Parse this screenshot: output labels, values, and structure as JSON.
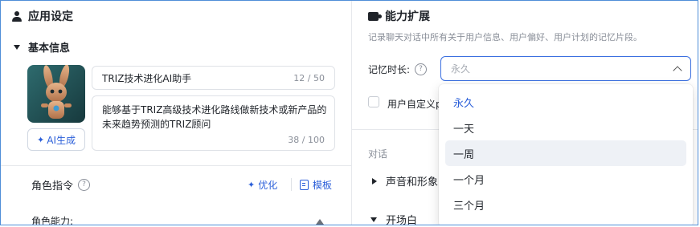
{
  "app_settings": {
    "title": "应用设定",
    "basic_info": {
      "label": "基本信息",
      "ai_generate_label": "AI生成",
      "name_value": "TRIZ技术进化AI助手",
      "name_counter": "12 / 50",
      "description_value": "能够基于TRIZ高级技术进化路线做新技术或新产品的未来趋势预测的TRIZ顾问",
      "description_counter": "38 / 100"
    },
    "role_instruction": {
      "label": "角色指令",
      "optimize_label": "优化",
      "template_label": "模板",
      "ability_label": "角色能力:"
    }
  },
  "capability_extension": {
    "title": "能力扩展",
    "description": "记录聊天对话中所有关于用户信息、用户偏好、用户计划的记忆片段。",
    "memory_duration": {
      "label": "记忆时长:",
      "placeholder": "永久",
      "options": [
        "永久",
        "一天",
        "一周",
        "一个月",
        "三个月"
      ],
      "selected": "永久",
      "hovered": "一周"
    },
    "custom_checkbox_label": "用户自定义p",
    "dialog_label": "对话",
    "voice_label": "声音和形象",
    "opening_label": "开场白"
  },
  "colors": {
    "accent": "#2b5fd9",
    "border_focus": "#3a6fe0",
    "muted_text": "#8a8f99"
  }
}
